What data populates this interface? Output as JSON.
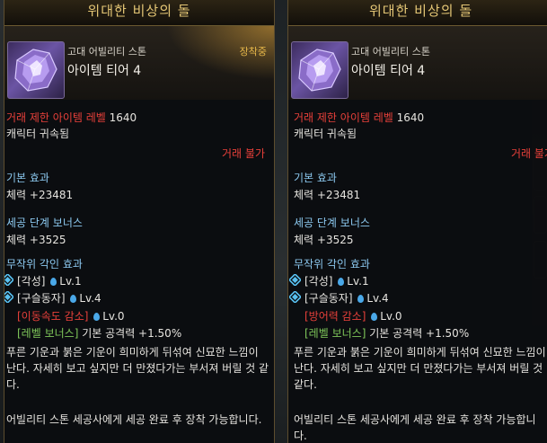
{
  "left": {
    "title": "위대한 비상의 돌",
    "category": "고대 어빌리티 스톤",
    "tier": "아이템 티어 4",
    "equipped": "장착중",
    "trade_level_label": "거래 제한 아이템 레벨",
    "trade_level_value": "1640",
    "bound": "캐릭터 귀속됨",
    "untradeable": "거래 불가",
    "base_effect_header": "기본 효과",
    "base_effect": "체력 +23481",
    "bonus_header": "세공 단계 보너스",
    "bonus": "체력 +3525",
    "engrave_header": "무작위 각인 효과",
    "engravings": [
      {
        "name": "[각성]",
        "level": "Lv.1"
      },
      {
        "name": "[구슬동자]",
        "level": "Lv.4"
      },
      {
        "name": "[이동속도 감소]",
        "level": "Lv.0"
      },
      {
        "name": "[레벨 보너스]",
        "value": "기본 공격력 +1.50%"
      }
    ],
    "flavor": "푸른 기운과 붉은 기운이 희미하게 뒤섞여 신묘한 느낌이 난다. 자세히 보고 싶지만 더 만졌다가는 부서져 버릴 것 같다.",
    "footer": "어빌리티 스톤 세공사에게 세공 완료 후 장착 가능합니다."
  },
  "right": {
    "title": "위대한 비상의 돌",
    "category": "고대 어빌리티 스톤",
    "tier": "아이템 티어 4",
    "trade_level_label": "거래 제한 아이템 레벨",
    "trade_level_value": "1640",
    "bound": "캐릭터 귀속됨",
    "untradeable": "거래 불가",
    "base_effect_header": "기본 효과",
    "base_effect": "체력 +23481",
    "bonus_header": "세공 단계 보너스",
    "bonus": "체력 +3525",
    "engrave_header": "무작위 각인 효과",
    "engravings": [
      {
        "name": "[각성]",
        "level": "Lv.1"
      },
      {
        "name": "[구슬동자]",
        "level": "Lv.4"
      },
      {
        "name": "[방어력 감소]",
        "level": "Lv.0"
      },
      {
        "name": "[레벨 보너스]",
        "value": "기본 공격력 +1.50%"
      }
    ],
    "flavor": "푸른 기운과 붉은 기운이 희미하게 뒤섞여 신묘한 느낌이 난다. 자세히 보고 싶지만 더 만졌다가는 부서져 버릴 것 같다.",
    "footer": "어빌리티 스톤 세공사에게 세공 완료 후 장착 가능합니다."
  },
  "colors": {
    "title_gold": "#e4c675",
    "equipped_orange": "#e9b94a",
    "red": "#e8403a",
    "blue_header": "#8cc9f0",
    "green": "#7fc85a",
    "drop_blue": "#4aa8e8"
  },
  "icons": {
    "stone": "ability-stone-icon",
    "engrave_active": "diamond-icon",
    "level_drop": "water-drop-icon"
  }
}
